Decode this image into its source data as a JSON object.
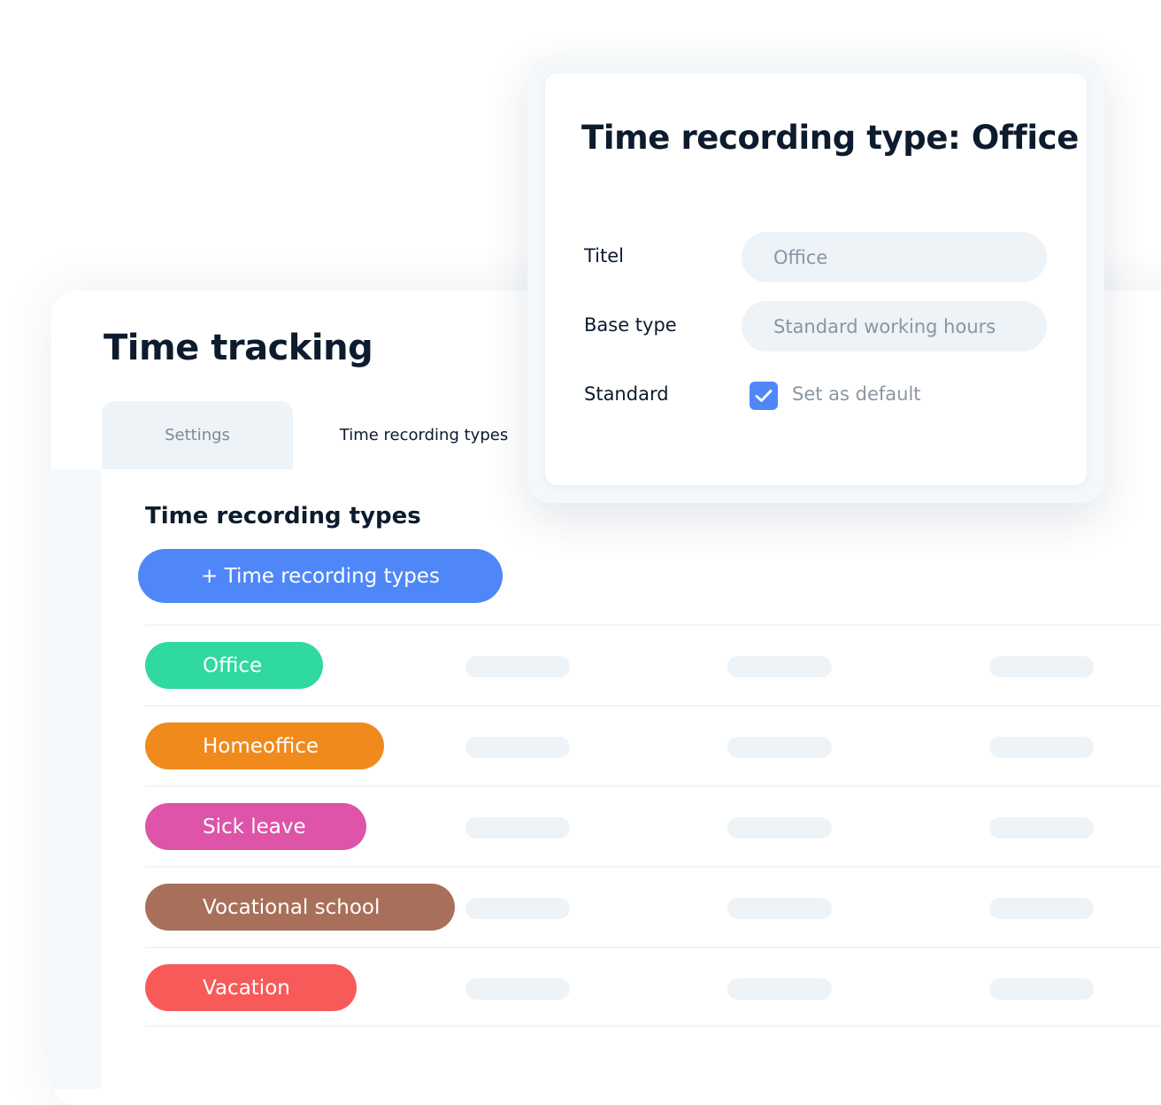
{
  "page": {
    "title": "Time tracking"
  },
  "tabs": [
    {
      "label": "Settings",
      "active": false
    },
    {
      "label": "Time recording types",
      "active": true
    }
  ],
  "section": {
    "title": "Time recording types",
    "add_button_label": "+ Time recording types"
  },
  "types": [
    {
      "label": "Office",
      "color": "#2fd99f"
    },
    {
      "label": "Homeoffice",
      "color": "#f08a1d"
    },
    {
      "label": "Sick leave",
      "color": "#dd54a9"
    },
    {
      "label": "Vocational school",
      "color": "#a8705a"
    },
    {
      "label": "Vacation",
      "color": "#f85a5a"
    }
  ],
  "modal": {
    "title": "Time recording type: Office",
    "fields": {
      "titel": {
        "label": "Titel",
        "value": "Office"
      },
      "base_type": {
        "label": "Base type",
        "value": "Standard working hours"
      },
      "standard": {
        "label": "Standard",
        "checkbox_label": "Set as default",
        "checked": true
      }
    }
  },
  "colors": {
    "accent": "#4f87f8",
    "heading": "#0d1b2e",
    "muted": "#8a96a2",
    "field_bg": "#eef3f7"
  }
}
